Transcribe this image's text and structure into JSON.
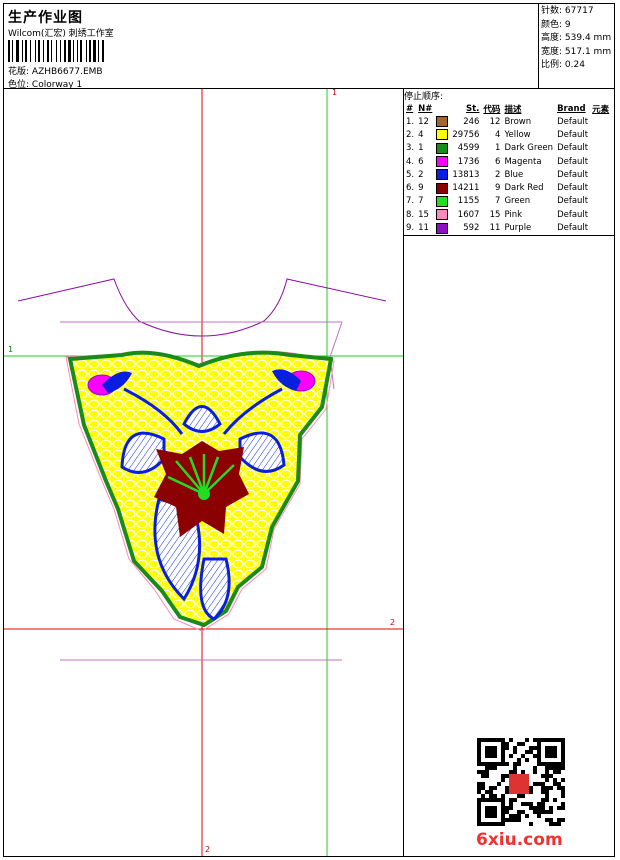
{
  "header": {
    "title": "生产作业图",
    "subtitle": "Wilcom(汇宏) 刺绣工作室",
    "design_file_label": "花版:",
    "design_file": "AZHB6677.EMB",
    "colorway_label": "色位:",
    "colorway": "Colorway 1"
  },
  "stats": {
    "stitches_label": "针数:",
    "stitches": "67717",
    "colors_label": "颜色:",
    "colors": "9",
    "height_label": "高度:",
    "height": "539.4 mm",
    "width_label": "宽度:",
    "width": "517.1 mm",
    "scale_label": "比例:",
    "scale": "0.24"
  },
  "sequence": {
    "title": "停止顺序:",
    "columns": [
      "#",
      "N#",
      "St.",
      "代码",
      "描述",
      "Brand",
      "元素"
    ],
    "rows": [
      {
        "idx": "1.",
        "n": "12",
        "color": "#a0682c",
        "st": "246",
        "code": "12",
        "desc": "Brown",
        "brand": "Default"
      },
      {
        "idx": "2.",
        "n": "4",
        "color": "#ffff00",
        "st": "29756",
        "code": "4",
        "desc": "Yellow",
        "brand": "Default"
      },
      {
        "idx": "3.",
        "n": "1",
        "color": "#1a8a1a",
        "st": "4599",
        "code": "1",
        "desc": "Dark Green",
        "brand": "Default"
      },
      {
        "idx": "4.",
        "n": "6",
        "color": "#ff00ff",
        "st": "1736",
        "code": "6",
        "desc": "Magenta",
        "brand": "Default"
      },
      {
        "idx": "5.",
        "n": "2",
        "color": "#0a1ee0",
        "st": "13813",
        "code": "2",
        "desc": "Blue",
        "brand": "Default"
      },
      {
        "idx": "6.",
        "n": "9",
        "color": "#8b0000",
        "st": "14211",
        "code": "9",
        "desc": "Dark Red",
        "brand": "Default"
      },
      {
        "idx": "7.",
        "n": "7",
        "color": "#22dd22",
        "st": "1155",
        "code": "7",
        "desc": "Green",
        "brand": "Default"
      },
      {
        "idx": "8.",
        "n": "15",
        "color": "#ff88bb",
        "st": "1607",
        "code": "15",
        "desc": "Pink",
        "brand": "Default"
      },
      {
        "idx": "9.",
        "n": "11",
        "color": "#8a10c0",
        "st": "592",
        "code": "11",
        "desc": "Purple",
        "brand": "Default"
      }
    ]
  },
  "guides": {
    "v_red_top": "1",
    "h_green_left": "1",
    "h_red_right": "2",
    "v_red_bottom": "2"
  },
  "watermark": "6xiu.com"
}
